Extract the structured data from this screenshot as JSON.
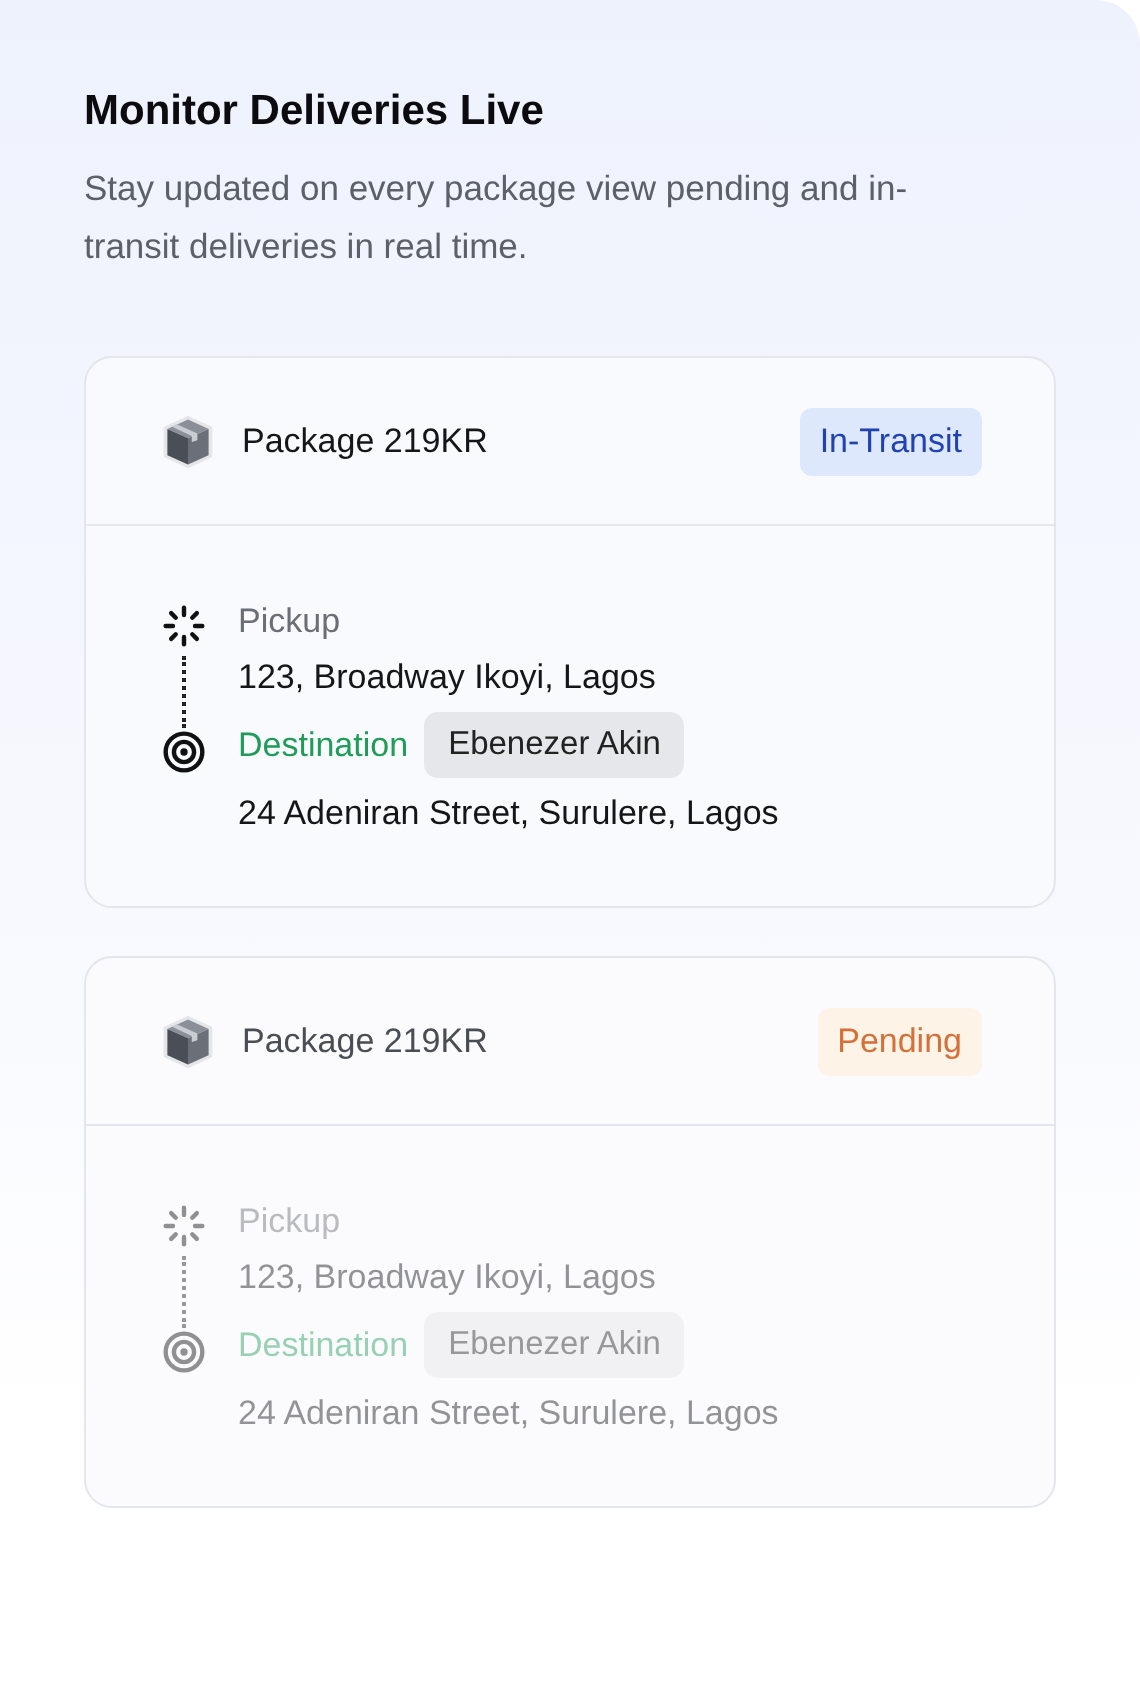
{
  "title": "Monitor Deliveries Live",
  "subtitle": "Stay updated on every package view pending and in-transit deliveries in real time.",
  "deliveries": [
    {
      "package": "Package 219KR",
      "status": {
        "label": "In-Transit",
        "kind": "in_transit"
      },
      "faded": false,
      "pickup": {
        "label": "Pickup",
        "address": "123, Broadway Ikoyi, Lagos"
      },
      "destination": {
        "label": "Destination",
        "recipient": "Ebenezer Akin",
        "address": "24 Adeniran Street, Surulere, Lagos"
      }
    },
    {
      "package": "Package 219KR",
      "status": {
        "label": "Pending",
        "kind": "pending"
      },
      "faded": true,
      "pickup": {
        "label": "Pickup",
        "address": "123, Broadway Ikoyi, Lagos"
      },
      "destination": {
        "label": "Destination",
        "recipient": "Ebenezer Akin",
        "address": "24 Adeniran Street, Surulere, Lagos"
      }
    }
  ]
}
